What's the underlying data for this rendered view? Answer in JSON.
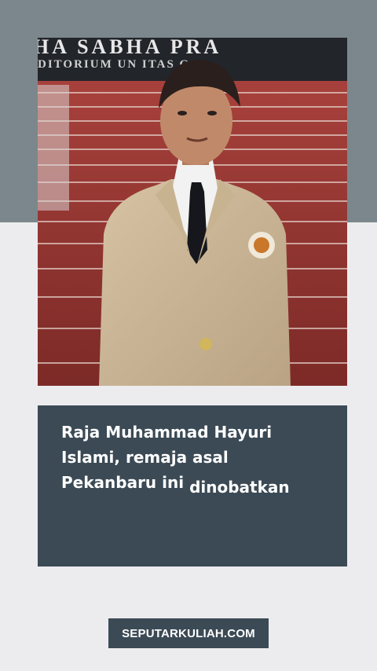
{
  "photo": {
    "banner_line1": "HA  SABHA  PRA",
    "banner_line2": "DITORIUM  UN     ITAS  GA"
  },
  "caption": {
    "line1": "Raja Muhammad Hayuri",
    "line2": "Islami, remaja asal",
    "line3a": "Pekanbaru ini",
    "line3b": "dinobatkan"
  },
  "brand": {
    "label": "SEPUTARKULIAH.COM"
  },
  "colors": {
    "top_band": "#7b878c",
    "card": "#3b4a55",
    "background": "#ececee"
  }
}
